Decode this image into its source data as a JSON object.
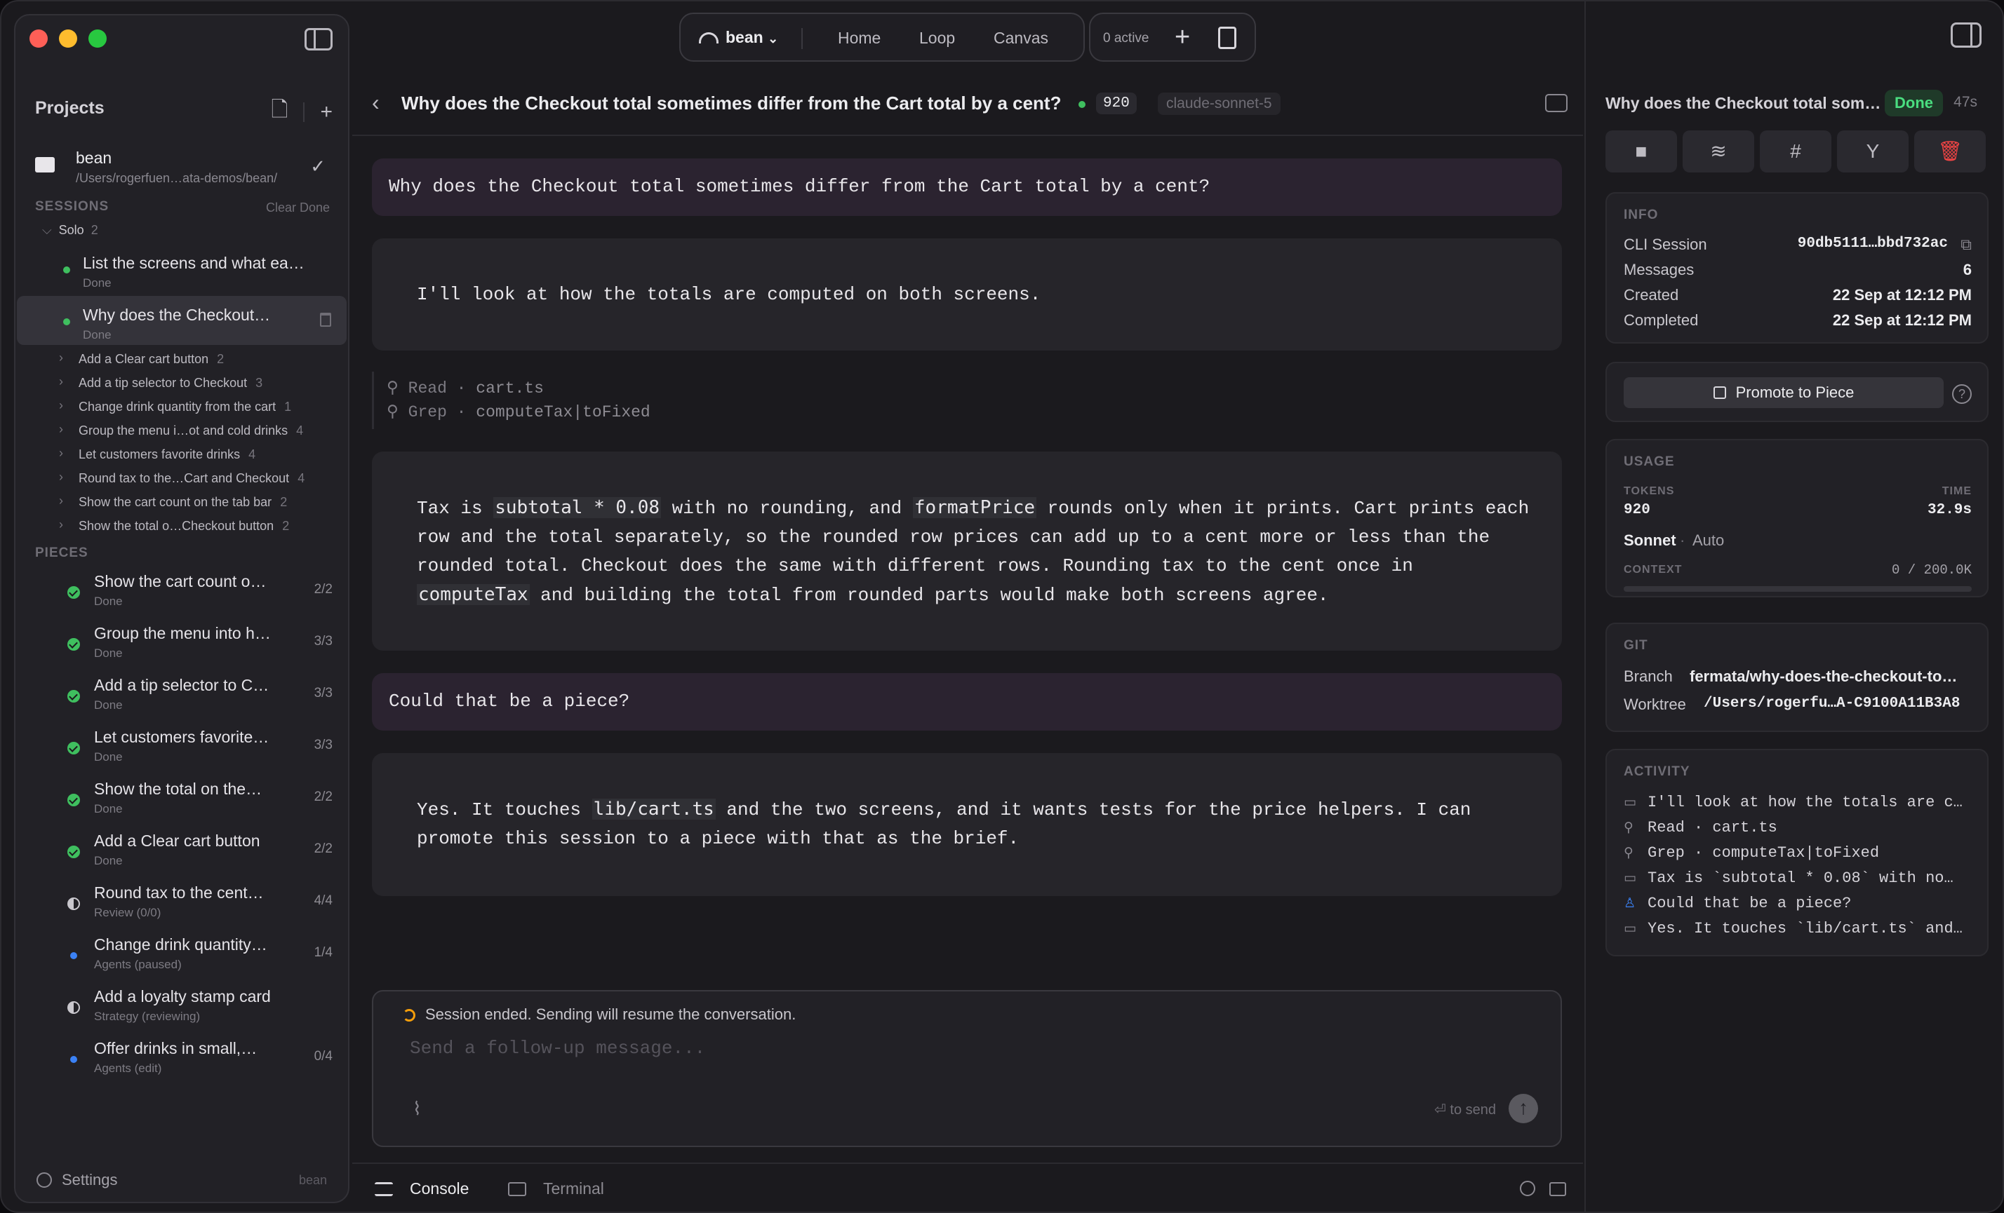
{
  "topbar": {
    "project": "bean",
    "nav": [
      "Home",
      "Loop",
      "Canvas"
    ],
    "active": "0 active"
  },
  "sidebar": {
    "projects_title": "Projects",
    "project": {
      "name": "bean",
      "path": "/Users/rogerfuen…ata-demos/bean/"
    },
    "sessions_title": "SESSIONS",
    "clear_done": "Clear Done",
    "group": {
      "name": "Solo",
      "count": "2"
    },
    "sessions": [
      {
        "title": "List the screens and what ea…",
        "status": "Done"
      },
      {
        "title": "Why does the Checkout…",
        "status": "Done"
      }
    ],
    "rows": [
      {
        "label": "Add a Clear cart button",
        "count": "2"
      },
      {
        "label": "Add a tip selector to Checkout",
        "count": "3"
      },
      {
        "label": "Change drink quantity from the cart",
        "count": "1"
      },
      {
        "label": "Group the menu i…ot and cold drinks",
        "count": "4"
      },
      {
        "label": "Let customers favorite drinks",
        "count": "4"
      },
      {
        "label": "Round tax to the…Cart and Checkout",
        "count": "4"
      },
      {
        "label": "Show the cart count on the tab bar",
        "count": "2"
      },
      {
        "label": "Show the total o…Checkout button",
        "count": "2"
      }
    ],
    "pieces_title": "PIECES",
    "pieces": [
      {
        "title": "Show the cart count o…",
        "status": "Done",
        "count": "2/2",
        "icon": "check-circle"
      },
      {
        "title": "Group the menu into h…",
        "status": "Done",
        "count": "3/3",
        "icon": "check-circle"
      },
      {
        "title": "Add a tip selector to C…",
        "status": "Done",
        "count": "3/3",
        "icon": "check-circle"
      },
      {
        "title": "Let customers favorite…",
        "status": "Done",
        "count": "3/3",
        "icon": "check-circle"
      },
      {
        "title": "Show the total on the…",
        "status": "Done",
        "count": "2/2",
        "icon": "check-circle"
      },
      {
        "title": "Add a Clear cart button",
        "status": "Done",
        "count": "2/2",
        "icon": "check-circle"
      },
      {
        "title": "Round tax to the cent…",
        "status": "Review (0/0)",
        "count": "4/4",
        "icon": "half-circle"
      },
      {
        "title": "Change drink quantity…",
        "status": "Agents (paused)",
        "count": "1/4",
        "icon": "blue-dot"
      },
      {
        "title": "Add a loyalty stamp card",
        "status": "Strategy (reviewing)",
        "count": "",
        "icon": "half-circle"
      },
      {
        "title": "Offer drinks in small,…",
        "status": "Agents (edit)",
        "count": "0/4",
        "icon": "blue-dot"
      }
    ],
    "settings": "Settings",
    "settings_project": "bean"
  },
  "conversation": {
    "title": "Why does the Checkout total sometimes differ from the Cart total by a cent?",
    "tokens": "920",
    "model": "claude-sonnet-5",
    "user_1": "Why does the Checkout total sometimes differ from the Cart total by a cent?",
    "assistant_1": "I'll look at how the totals are computed on both screens.",
    "tools": [
      {
        "name": "Read",
        "arg": "cart.ts"
      },
      {
        "name": "Grep",
        "arg": "computeTax|toFixed"
      }
    ],
    "assistant_2": {
      "p1": "Tax is ",
      "c1": "subtotal * 0.08",
      "p2": " with no rounding, and ",
      "c2": "formatPrice",
      "p3": " rounds only when it prints. Cart prints each\nrow and the total separately, so the rounded row prices can add up to a cent more or less than the\nrounded total. Checkout does the same with different rows. Rounding tax to the cent once in\n",
      "c3": "computeTax",
      "p4": " and building the total from rounded parts would make both screens agree."
    },
    "user_2": "Could that be a piece?",
    "assistant_3": {
      "p1": "Yes. It touches ",
      "c1": "lib/cart.ts",
      "p2": " and the two screens, and it wants tests for the price helpers. I can\npromote this session to a piece with that as the brief."
    }
  },
  "composer": {
    "status": "Session ended. Sending will resume the conversation.",
    "placeholder": "Send a follow-up message...",
    "hint": "⏎ to send"
  },
  "bottom_tabs": [
    "Console",
    "Terminal"
  ],
  "details": {
    "title": "Why does the Checkout total som…",
    "status": "Done",
    "elapsed": "47s",
    "info_title": "INFO",
    "info": [
      {
        "k": "CLI Session",
        "v": "90db5111…bbd732ac"
      },
      {
        "k": "Messages",
        "v": "6"
      },
      {
        "k": "Created",
        "v": "22 Sep at 12:12 PM"
      },
      {
        "k": "Completed",
        "v": "22 Sep at 12:12 PM"
      }
    ],
    "promote": "Promote to Piece",
    "usage_title": "USAGE",
    "tokens_label": "TOKENS",
    "tokens": "920",
    "time_label": "TIME",
    "time": "32.9s",
    "model": "Sonnet",
    "mode": "Auto",
    "context_label": "CONTEXT",
    "context": "0 / 200.0K",
    "context_fraction": 0,
    "git_title": "GIT",
    "branch_label": "Branch",
    "branch": "fermata/why-does-the-checkout-to…",
    "worktree_label": "Worktree",
    "worktree": "/Users/rogerfu…A-C9100A11B3A8",
    "activity_title": "ACTIVITY",
    "activity": [
      {
        "icon": "message-icon",
        "text": "I'll look at how the totals are c…"
      },
      {
        "icon": "wrench-icon",
        "text": "Read · cart.ts"
      },
      {
        "icon": "wrench-icon",
        "text": "Grep · computeTax|toFixed"
      },
      {
        "icon": "message-icon",
        "text": "Tax is `subtotal * 0.08` with no…"
      },
      {
        "icon": "user-icon",
        "text": "Could that be a piece?"
      },
      {
        "icon": "message-icon",
        "text": "Yes. It touches `lib/cart.ts` and…"
      }
    ]
  }
}
